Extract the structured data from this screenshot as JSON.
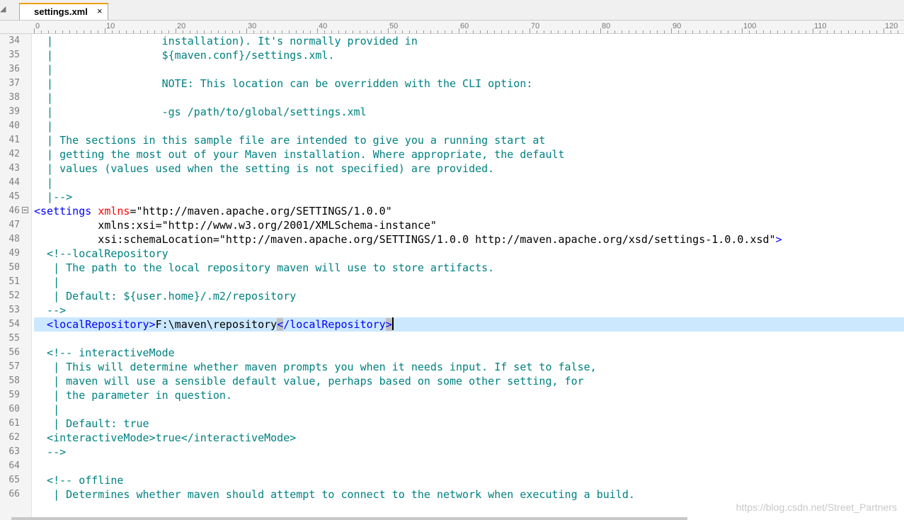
{
  "tab": {
    "title": "settings.xml",
    "close_glyph": "×",
    "left_arrow": "◢"
  },
  "ruler": {
    "labels": [
      "0",
      "10",
      "20",
      "30",
      "40",
      "50",
      "60",
      "70",
      "80",
      "90",
      "100",
      "110",
      "120"
    ]
  },
  "lines": [
    {
      "n": "34",
      "spans": [
        {
          "c": "comment",
          "t": "  |                 installation). It's normally provided in"
        }
      ]
    },
    {
      "n": "35",
      "spans": [
        {
          "c": "comment",
          "t": "  |                 ${maven.conf}/settings.xml."
        }
      ]
    },
    {
      "n": "36",
      "spans": [
        {
          "c": "comment",
          "t": "  |"
        }
      ]
    },
    {
      "n": "37",
      "spans": [
        {
          "c": "comment",
          "t": "  |                 NOTE: This location can be overridden with the CLI option:"
        }
      ]
    },
    {
      "n": "38",
      "spans": [
        {
          "c": "comment",
          "t": "  |"
        }
      ]
    },
    {
      "n": "39",
      "spans": [
        {
          "c": "comment",
          "t": "  |                 -gs /path/to/global/settings.xml"
        }
      ]
    },
    {
      "n": "40",
      "spans": [
        {
          "c": "comment",
          "t": "  |"
        }
      ]
    },
    {
      "n": "41",
      "spans": [
        {
          "c": "comment",
          "t": "  | The sections in this sample file are intended to give you a running start at"
        }
      ]
    },
    {
      "n": "42",
      "spans": [
        {
          "c": "comment",
          "t": "  | getting the most out of your Maven installation. Where appropriate, the default"
        }
      ]
    },
    {
      "n": "43",
      "spans": [
        {
          "c": "comment",
          "t": "  | values (values used when the setting is not specified) are provided."
        }
      ]
    },
    {
      "n": "44",
      "spans": [
        {
          "c": "comment",
          "t": "  |"
        }
      ]
    },
    {
      "n": "45",
      "spans": [
        {
          "c": "comment",
          "t": "  |-->"
        }
      ]
    },
    {
      "n": "46",
      "fold": true,
      "spans": [
        {
          "c": "tag",
          "t": "<settings "
        },
        {
          "c": "attr",
          "t": "xmlns"
        },
        {
          "c": "plain",
          "t": "="
        },
        {
          "c": "val",
          "t": "\"http://maven.apache.org/SETTINGS/1.0.0\""
        }
      ]
    },
    {
      "n": "47",
      "spans": [
        {
          "c": "plain",
          "t": "          xmlns:xsi"
        },
        {
          "c": "plain",
          "t": "="
        },
        {
          "c": "val",
          "t": "\"http://www.w3.org/2001/XMLSchema-instance\""
        }
      ]
    },
    {
      "n": "48",
      "spans": [
        {
          "c": "plain",
          "t": "          xsi:schemaLocation"
        },
        {
          "c": "plain",
          "t": "="
        },
        {
          "c": "val",
          "t": "\"http://maven.apache.org/SETTINGS/1.0.0 http://maven.apache.org/xsd/settings-1.0.0.xsd\""
        },
        {
          "c": "tag",
          "t": ">"
        }
      ]
    },
    {
      "n": "49",
      "spans": [
        {
          "c": "comment",
          "t": "  <!--localRepository"
        }
      ]
    },
    {
      "n": "50",
      "spans": [
        {
          "c": "comment",
          "t": "   | The path to the local repository maven will use to store artifacts."
        }
      ]
    },
    {
      "n": "51",
      "spans": [
        {
          "c": "comment",
          "t": "   |"
        }
      ]
    },
    {
      "n": "52",
      "spans": [
        {
          "c": "comment",
          "t": "   | Default: ${user.home}/.m2/repository"
        }
      ]
    },
    {
      "n": "53",
      "spans": [
        {
          "c": "comment",
          "t": "  -->"
        }
      ]
    },
    {
      "n": "54",
      "current": true,
      "spans": [
        {
          "c": "tag",
          "t": "  <localRepository>"
        },
        {
          "c": "plain",
          "t": "F:\\maven\\repository"
        },
        {
          "c": "tag match",
          "t": "<"
        },
        {
          "c": "tag",
          "t": "/localRepository"
        },
        {
          "c": "tag match",
          "t": ">"
        },
        {
          "c": "caret",
          "t": ""
        }
      ]
    },
    {
      "n": "55",
      "spans": [
        {
          "c": "plain",
          "t": ""
        }
      ]
    },
    {
      "n": "56",
      "spans": [
        {
          "c": "comment",
          "t": "  <!-- interactiveMode"
        }
      ]
    },
    {
      "n": "57",
      "spans": [
        {
          "c": "comment",
          "t": "   | This will determine whether maven prompts you when it needs input. If set to false,"
        }
      ]
    },
    {
      "n": "58",
      "spans": [
        {
          "c": "comment",
          "t": "   | maven will use a sensible default value, perhaps based on some other setting, for"
        }
      ]
    },
    {
      "n": "59",
      "spans": [
        {
          "c": "comment",
          "t": "   | the parameter in question."
        }
      ]
    },
    {
      "n": "60",
      "spans": [
        {
          "c": "comment",
          "t": "   |"
        }
      ]
    },
    {
      "n": "61",
      "spans": [
        {
          "c": "comment",
          "t": "   | Default: true"
        }
      ]
    },
    {
      "n": "62",
      "spans": [
        {
          "c": "comment",
          "t": "  <interactiveMode>true</interactiveMode>"
        }
      ]
    },
    {
      "n": "63",
      "spans": [
        {
          "c": "comment",
          "t": "  -->"
        }
      ]
    },
    {
      "n": "64",
      "spans": [
        {
          "c": "plain",
          "t": ""
        }
      ]
    },
    {
      "n": "65",
      "spans": [
        {
          "c": "comment",
          "t": "  <!-- offline"
        }
      ]
    },
    {
      "n": "66",
      "spans": [
        {
          "c": "comment",
          "t": "   | Determines whether maven should attempt to connect to the network when executing a build."
        }
      ]
    }
  ],
  "watermark": "https://blog.csdn.net/Street_Partners"
}
